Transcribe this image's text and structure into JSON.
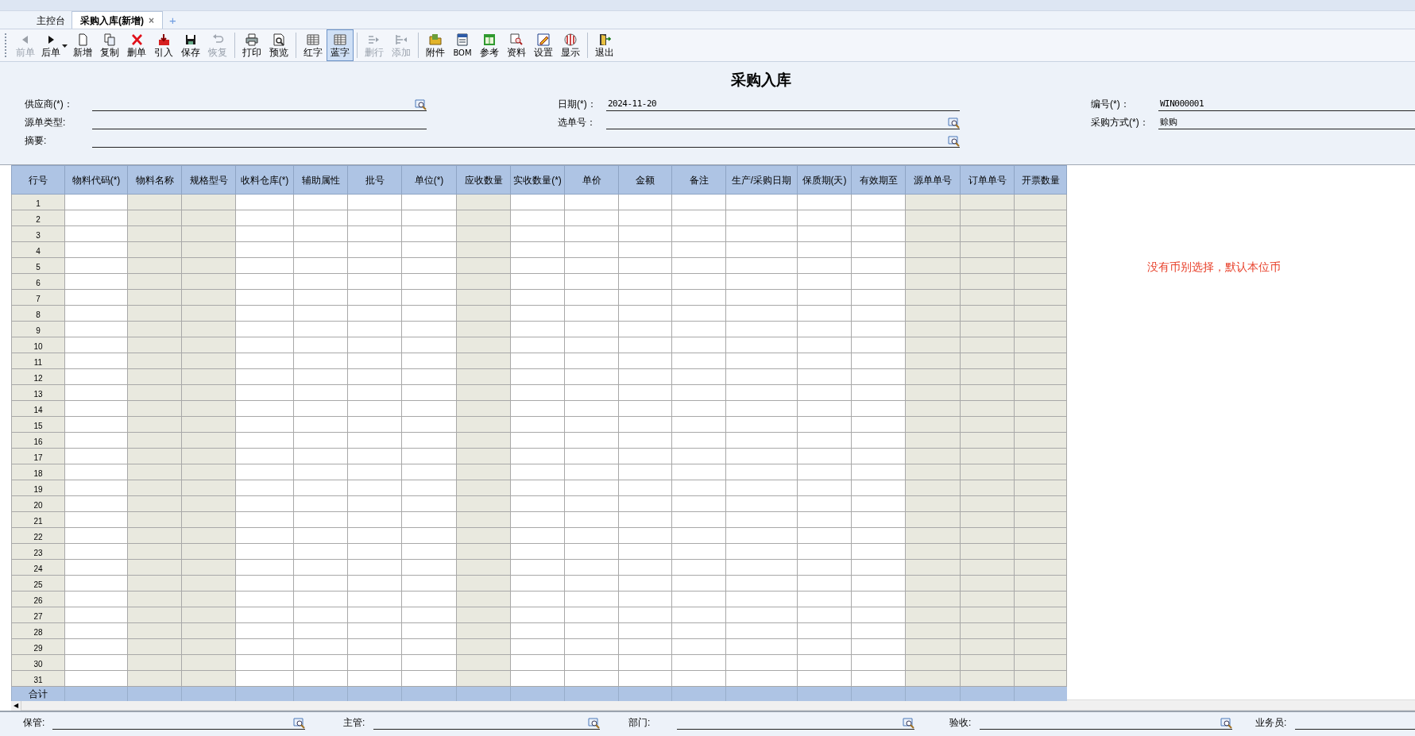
{
  "tabs": [
    {
      "label": "主控台",
      "selected": false
    },
    {
      "label": "采购入库(新增)",
      "selected": true,
      "close_symbol": "×"
    }
  ],
  "new_tab_symbol": "+",
  "toolbar_groups": [
    [
      {
        "label": "前单",
        "disabled": true,
        "selected": false,
        "dropdown": false
      },
      {
        "label": "后单",
        "disabled": false,
        "selected": false,
        "dropdown": true
      },
      {
        "label": "新增",
        "disabled": false,
        "selected": false,
        "dropdown": false
      },
      {
        "label": "复制",
        "disabled": false,
        "selected": false,
        "dropdown": false
      },
      {
        "label": "删单",
        "disabled": false,
        "selected": false,
        "dropdown": false
      },
      {
        "label": "引入",
        "disabled": false,
        "selected": false,
        "dropdown": false
      },
      {
        "label": "保存",
        "disabled": false,
        "selected": false,
        "dropdown": false
      },
      {
        "label": "恢复",
        "disabled": true,
        "selected": false,
        "dropdown": false
      }
    ],
    [
      {
        "label": "打印",
        "disabled": false,
        "selected": false,
        "dropdown": false
      },
      {
        "label": "预览",
        "disabled": false,
        "selected": false,
        "dropdown": false
      }
    ],
    [
      {
        "label": "红字",
        "disabled": false,
        "selected": false,
        "dropdown": false
      },
      {
        "label": "蓝字",
        "disabled": false,
        "selected": true,
        "dropdown": false
      }
    ],
    [
      {
        "label": "删行",
        "disabled": true,
        "selected": false,
        "dropdown": false
      },
      {
        "label": "添加",
        "disabled": true,
        "selected": false,
        "dropdown": false
      }
    ],
    [
      {
        "label": "附件",
        "disabled": false,
        "selected": false,
        "dropdown": false
      },
      {
        "label": "BOM",
        "disabled": false,
        "selected": false,
        "dropdown": false
      },
      {
        "label": "参考",
        "disabled": false,
        "selected": false,
        "dropdown": false
      },
      {
        "label": "资料",
        "disabled": false,
        "selected": false,
        "dropdown": false
      },
      {
        "label": "设置",
        "disabled": false,
        "selected": false,
        "dropdown": false
      },
      {
        "label": "显示",
        "disabled": false,
        "selected": false,
        "dropdown": false
      }
    ],
    [
      {
        "label": "退出",
        "disabled": false,
        "selected": false,
        "dropdown": false
      }
    ]
  ],
  "form_title": "采购入库",
  "header_rows": [
    [
      {
        "label": "供应商(*)：",
        "lookup": true
      },
      {
        "label": "日期(*)：",
        "value": "2024-11-20",
        "lookup": false
      },
      {
        "label": "编号(*)：",
        "value": "WIN000001",
        "lookup": false
      }
    ],
    [
      {
        "label": "源单类型:",
        "lookup": false
      },
      {
        "label": "选单号：",
        "lookup": true
      },
      {
        "label": "采购方式(*)：",
        "value": "赊购",
        "lookup": false
      }
    ]
  ],
  "summary_field": {
    "label": "摘要:",
    "lookup": true
  },
  "table": {
    "columns": [
      {
        "label": "行号",
        "readonly": true
      },
      {
        "label": "物料代码(*)",
        "readonly": false
      },
      {
        "label": "物料名称",
        "readonly": true
      },
      {
        "label": "规格型号",
        "readonly": true
      },
      {
        "label": "收料仓库(*)",
        "readonly": false
      },
      {
        "label": "辅助属性",
        "readonly": false
      },
      {
        "label": "批号",
        "readonly": false
      },
      {
        "label": "单位(*)",
        "readonly": false
      },
      {
        "label": "应收数量",
        "readonly": true
      },
      {
        "label": "实收数量(*)",
        "readonly": false
      },
      {
        "label": "单价",
        "readonly": false
      },
      {
        "label": "金额",
        "readonly": false
      },
      {
        "label": "备注",
        "readonly": false
      },
      {
        "label": "生产/采购日期",
        "readonly": false
      },
      {
        "label": "保质期(天)",
        "readonly": false
      },
      {
        "label": "有效期至",
        "readonly": false
      },
      {
        "label": "源单单号",
        "readonly": true
      },
      {
        "label": "订单单号",
        "readonly": true
      },
      {
        "label": "开票数量",
        "readonly": true
      }
    ],
    "rows": [
      "1",
      "2",
      "3",
      "4",
      "5",
      "6",
      "7",
      "8",
      "9",
      "10",
      "11",
      "12",
      "13",
      "14",
      "15",
      "16",
      "17",
      "18",
      "19",
      "20",
      "21",
      "22",
      "23",
      "24",
      "25",
      "26",
      "27",
      "28",
      "29",
      "30",
      "31"
    ],
    "total_label": "合计"
  },
  "scroll_left_symbol": "◀",
  "currency_note": "没有币别选择，默认本位币",
  "footer_fields": [
    {
      "label": "保管:",
      "lookup": true
    },
    {
      "label": "主管:",
      "lookup": true
    },
    {
      "label": "部门:",
      "lookup": true
    },
    {
      "label": "验收:",
      "lookup": true
    },
    {
      "label": "业务员:",
      "lookup": false
    }
  ]
}
